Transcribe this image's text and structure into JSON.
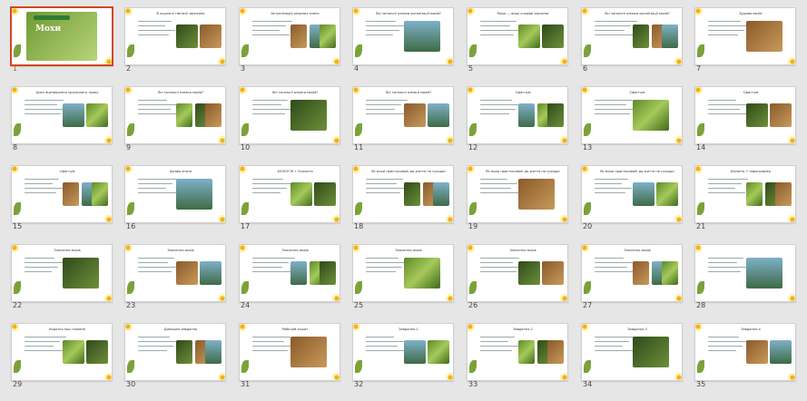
{
  "thumbnails": [
    {
      "n": "1",
      "title": "Мохи",
      "selected": true
    },
    {
      "n": "2",
      "title": "В журналі гімназії записано",
      "selected": false
    },
    {
      "n": "3",
      "title": "Актуалізація опорних знань",
      "selected": false
    },
    {
      "n": "4",
      "title": "Які загальні ознаки організації мохів?",
      "selected": false
    },
    {
      "n": "5",
      "title": "Мохи — вищі спорові рослини",
      "selected": false
    },
    {
      "n": "6",
      "title": "Які загальні ознаки організації мохів?",
      "selected": false
    },
    {
      "n": "7",
      "title": "Будова мохів",
      "selected": false
    },
    {
      "n": "8",
      "title": "Цикл відтворення зозулиного льону",
      "selected": false
    },
    {
      "n": "9",
      "title": "Які загальні ознаки мохів?",
      "selected": false
    },
    {
      "n": "10",
      "title": "Які загальні ознаки мохів?",
      "selected": false
    },
    {
      "n": "11",
      "title": "Які загальні ознаки мохів?",
      "selected": false
    },
    {
      "n": "12",
      "title": "Сфагнум",
      "selected": false
    },
    {
      "n": "13",
      "title": "Сфагнум",
      "selected": false
    },
    {
      "n": "14",
      "title": "Сфагнум",
      "selected": false
    },
    {
      "n": "15",
      "title": "Сфагнум",
      "selected": false
    },
    {
      "n": "16",
      "title": "Цікаво знати",
      "selected": false
    },
    {
      "n": "17",
      "title": "БІОЛОГІЯ + Екологія",
      "selected": false
    },
    {
      "n": "18",
      "title": "Як мохи пристосовані до життя на суходолі?",
      "selected": false
    },
    {
      "n": "19",
      "title": "Як мохи пристосовані до життя на суходолі?",
      "selected": false
    },
    {
      "n": "20",
      "title": "Як мохи пристосовані до життя на суходолі?",
      "selected": false
    },
    {
      "n": "21",
      "title": "Біологія + Інфографіка",
      "selected": false
    },
    {
      "n": "22",
      "title": "Значення мохів",
      "selected": false
    },
    {
      "n": "23",
      "title": "Значення мохів",
      "selected": false
    },
    {
      "n": "24",
      "title": "Значення мохів",
      "selected": false
    },
    {
      "n": "25",
      "title": "Значення мохів",
      "selected": false
    },
    {
      "n": "26",
      "title": "Значення мохів",
      "selected": false
    },
    {
      "n": "27",
      "title": "Значення мохів",
      "selected": false
    },
    {
      "n": "28",
      "title": "",
      "selected": false
    },
    {
      "n": "29",
      "title": "Коротко про головне",
      "selected": false
    },
    {
      "n": "30",
      "title": "Домашнє завдання",
      "selected": false
    },
    {
      "n": "31",
      "title": "Робочий зошит",
      "selected": false
    },
    {
      "n": "32",
      "title": "Завдання 1",
      "selected": false
    },
    {
      "n": "33",
      "title": "Завдання 2",
      "selected": false
    },
    {
      "n": "34",
      "title": "Завдання 3",
      "selected": false
    },
    {
      "n": "35",
      "title": "Завдання 4",
      "selected": false
    }
  ]
}
